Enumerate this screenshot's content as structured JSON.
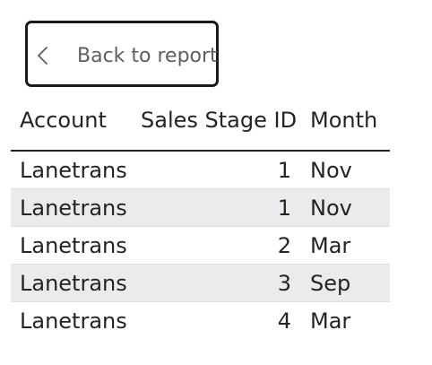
{
  "back_button": {
    "label": "Back to report",
    "icon": "chevron-left-icon"
  },
  "table": {
    "columns": [
      "Account",
      "Sales Stage ID",
      "Month"
    ],
    "rows": [
      {
        "account": "Lanetrans",
        "sales_stage_id": "1",
        "month": "Nov"
      },
      {
        "account": "Lanetrans",
        "sales_stage_id": "1",
        "month": "Nov"
      },
      {
        "account": "Lanetrans",
        "sales_stage_id": "2",
        "month": "Mar"
      },
      {
        "account": "Lanetrans",
        "sales_stage_id": "3",
        "month": "Sep"
      },
      {
        "account": "Lanetrans",
        "sales_stage_id": "4",
        "month": "Mar"
      }
    ]
  },
  "colors": {
    "text": "#252423",
    "muted_text": "#605e5c",
    "alt_row": "#e9ebed",
    "border": "#1b1b1b"
  }
}
